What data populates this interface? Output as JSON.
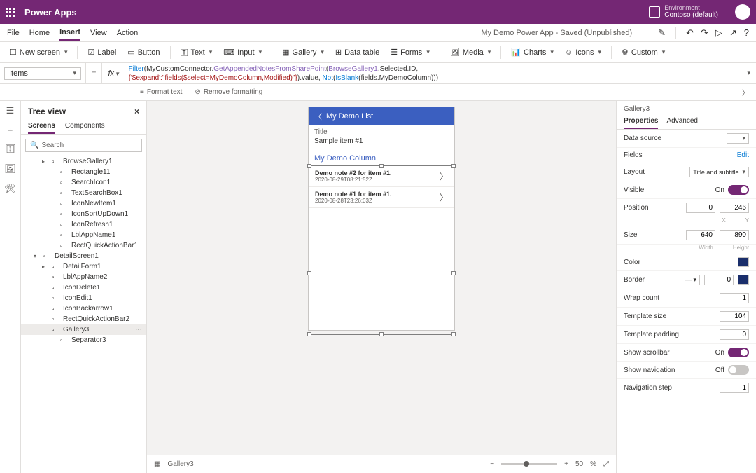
{
  "header": {
    "app": "Power Apps",
    "env_label": "Environment",
    "env_name": "Contoso (default)"
  },
  "menu": {
    "items": [
      "File",
      "Home",
      "Insert",
      "View",
      "Action"
    ],
    "active": "Insert",
    "doc": "My Demo Power App - Saved (Unpublished)"
  },
  "toolbar": {
    "newscreen": "New screen",
    "label": "Label",
    "button": "Button",
    "text": "Text",
    "input": "Input",
    "gallery": "Gallery",
    "datatable": "Data table",
    "forms": "Forms",
    "media": "Media",
    "charts": "Charts",
    "icons": "Icons",
    "custom": "Custom"
  },
  "fx": {
    "prop": "Items",
    "formula_parts": [
      "Filter",
      "(MyCustomConnector.",
      "GetAppendedNotesFromSharePoint",
      "(",
      "BrowseGallery1",
      ".Selected.ID,",
      "{'$expand':\"fields($select=MyDemoColumn,Modified)\"}",
      ").value, ",
      "Not",
      "(",
      "IsBlank",
      "(fields.MyDemoColumn)))"
    ]
  },
  "fmt": {
    "format": "Format text",
    "remove": "Remove formatting"
  },
  "tree": {
    "title": "Tree view",
    "tabs": [
      "Screens",
      "Components"
    ],
    "search": "Search",
    "nodes": [
      {
        "lvl": 2,
        "label": "BrowseGallery1",
        "caret": "▸"
      },
      {
        "lvl": 3,
        "label": "Rectangle11"
      },
      {
        "lvl": 3,
        "label": "SearchIcon1"
      },
      {
        "lvl": 3,
        "label": "TextSearchBox1"
      },
      {
        "lvl": 3,
        "label": "IconNewItem1"
      },
      {
        "lvl": 3,
        "label": "IconSortUpDown1"
      },
      {
        "lvl": 3,
        "label": "IconRefresh1"
      },
      {
        "lvl": 3,
        "label": "LblAppName1"
      },
      {
        "lvl": 3,
        "label": "RectQuickActionBar1"
      },
      {
        "lvl": 1,
        "label": "DetailScreen1",
        "caret": "▾"
      },
      {
        "lvl": 2,
        "label": "DetailForm1",
        "caret": "▸"
      },
      {
        "lvl": 2,
        "label": "LblAppName2"
      },
      {
        "lvl": 2,
        "label": "IconDelete1"
      },
      {
        "lvl": 2,
        "label": "IconEdit1"
      },
      {
        "lvl": 2,
        "label": "IconBackarrow1"
      },
      {
        "lvl": 2,
        "label": "RectQuickActionBar2"
      },
      {
        "lvl": 2,
        "label": "Gallery3",
        "sel": true
      },
      {
        "lvl": 3,
        "label": "Separator3"
      }
    ]
  },
  "phone": {
    "header": "My Demo List",
    "title_lbl": "Title",
    "item": "Sample item #1",
    "col": "My Demo Column",
    "rows": [
      {
        "t": "Demo note #2 for item #1.",
        "d": "2020-08-29T08:21:52Z"
      },
      {
        "t": "Demo note #1 for item #1.",
        "d": "2020-08-28T23:26:03Z"
      }
    ]
  },
  "footer": {
    "crumb": "Gallery3",
    "zoom": "50",
    "pct": "%"
  },
  "props": {
    "name": "Gallery3",
    "tabs": [
      "Properties",
      "Advanced"
    ],
    "datasource": "Data source",
    "fields": "Fields",
    "fields_link": "Edit",
    "layout": "Layout",
    "layout_val": "Title and subtitle",
    "visible": "Visible",
    "visible_on": "On",
    "position": "Position",
    "pos_x": "0",
    "pos_y": "246",
    "pos_lx": "X",
    "pos_ly": "Y",
    "size": "Size",
    "w": "640",
    "h": "890",
    "wl": "Width",
    "hl": "Height",
    "color": "Color",
    "border": "Border",
    "border_v": "0",
    "wrap": "Wrap count",
    "wrap_v": "1",
    "tsize": "Template size",
    "tsize_v": "104",
    "tpad": "Template padding",
    "tpad_v": "0",
    "scroll": "Show scrollbar",
    "scroll_on": "On",
    "nav": "Show navigation",
    "nav_off": "Off",
    "navstep": "Navigation step",
    "navstep_v": "1"
  }
}
